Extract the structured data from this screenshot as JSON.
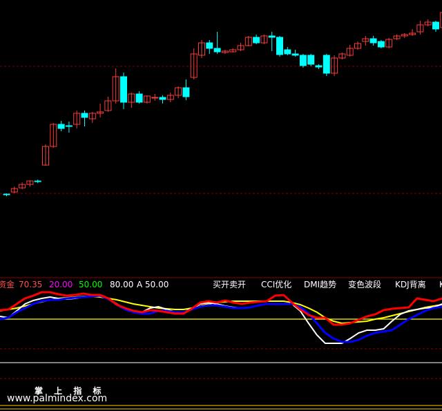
{
  "chart_data": {
    "type": "candlestick",
    "colors": {
      "background": "#000000",
      "up": "#ff3b3b",
      "down": "#00ffff",
      "grid": "#8b0000",
      "line_white": "#ffffff",
      "line_blue": "#0000ff",
      "line_red": "#ff0000",
      "line_yellow": "#ffff00"
    },
    "candles": [
      [
        281,
        282,
        280,
        284
      ],
      [
        278,
        273,
        270,
        280
      ],
      [
        272,
        267,
        264,
        274
      ],
      [
        267,
        262,
        261,
        270
      ],
      [
        262,
        263,
        260,
        265
      ],
      [
        239,
        212,
        209,
        240
      ],
      [
        212,
        180,
        178,
        214
      ],
      [
        180,
        186,
        175,
        190
      ],
      [
        182,
        182,
        176,
        192
      ],
      [
        180,
        164,
        160,
        186
      ],
      [
        164,
        170,
        160,
        183
      ],
      [
        172,
        164,
        162,
        178
      ],
      [
        164,
        162,
        150,
        170
      ],
      [
        160,
        146,
        140,
        162
      ],
      [
        146,
        111,
        99,
        150
      ],
      [
        111,
        148,
        105,
        158
      ],
      [
        148,
        136,
        134,
        156
      ],
      [
        136,
        148,
        132,
        150
      ],
      [
        148,
        139,
        138,
        150
      ],
      [
        142,
        141,
        136,
        146
      ],
      [
        141,
        144,
        138,
        150
      ],
      [
        144,
        138,
        134,
        148
      ],
      [
        138,
        127,
        125,
        142
      ],
      [
        127,
        140,
        115,
        145
      ],
      [
        112,
        78,
        70,
        115
      ],
      [
        80,
        62,
        58,
        84
      ],
      [
        62,
        70,
        58,
        78
      ],
      [
        70,
        75,
        46,
        78
      ],
      [
        76,
        74,
        72,
        78
      ],
      [
        75,
        72,
        70,
        76
      ],
      [
        72,
        66,
        62,
        74
      ],
      [
        66,
        54,
        52,
        67
      ],
      [
        54,
        62,
        50,
        64
      ],
      [
        62,
        52,
        50,
        64
      ],
      [
        52,
        54,
        46,
        74
      ],
      [
        54,
        79,
        52,
        82
      ],
      [
        72,
        78,
        68,
        80
      ],
      [
        78,
        80,
        72,
        82
      ],
      [
        80,
        95,
        78,
        98
      ],
      [
        80,
        93,
        78,
        96
      ],
      [
        95,
        97,
        93,
        100
      ],
      [
        80,
        106,
        78,
        110
      ],
      [
        106,
        84,
        80,
        110
      ],
      [
        84,
        78,
        76,
        86
      ],
      [
        80,
        70,
        65,
        82
      ],
      [
        70,
        63,
        60,
        72
      ],
      [
        60,
        56,
        52,
        66
      ],
      [
        56,
        62,
        52,
        66
      ],
      [
        60,
        68,
        58,
        70
      ],
      [
        68,
        57,
        55,
        70
      ],
      [
        56,
        52,
        50,
        58
      ],
      [
        52,
        50,
        48,
        55
      ],
      [
        50,
        48,
        42,
        52
      ],
      [
        46,
        36,
        30,
        50
      ],
      [
        36,
        32,
        28,
        38
      ],
      [
        32,
        42,
        30,
        46
      ],
      [
        40,
        18,
        10,
        45
      ]
    ],
    "ref_lines": [
      96,
      280
    ],
    "indicator": {
      "ref_lines": [
        462,
        505,
        525,
        548
      ],
      "white": [
        458,
        460,
        450,
        440,
        435,
        432,
        430,
        432,
        433,
        432,
        430,
        428,
        427,
        432,
        440,
        448,
        452,
        452,
        446,
        444,
        448,
        452,
        452,
        446,
        440,
        438,
        440,
        443,
        445,
        446,
        445,
        442,
        440,
        440,
        440,
        440,
        450,
        468,
        485,
        497,
        497,
        497,
        490,
        482,
        478,
        478,
        476,
        465,
        455,
        450,
        448,
        446,
        445,
        440
      ],
      "blue": [
        462,
        460,
        452,
        446,
        440,
        436,
        434,
        434,
        432,
        431,
        430,
        429,
        428,
        433,
        441,
        448,
        452,
        454,
        454,
        450,
        450,
        452,
        452,
        448,
        444,
        442,
        442,
        444,
        446,
        446,
        445,
        442,
        440,
        440,
        440,
        440,
        444,
        454,
        468,
        482,
        490,
        495,
        495,
        492,
        486,
        482,
        480,
        478,
        470,
        462,
        456,
        450,
        446,
        444
      ],
      "red": [
        449,
        448,
        440,
        432,
        428,
        423,
        423,
        426,
        428,
        427,
        425,
        427,
        427,
        432,
        441,
        446,
        450,
        452,
        449,
        450,
        452,
        454,
        454,
        447,
        438,
        436,
        438,
        435,
        438,
        440,
        438,
        437,
        436,
        428,
        427,
        438,
        448,
        456,
        460,
        460,
        470,
        470,
        468,
        463,
        458,
        455,
        449,
        447,
        446,
        445,
        432,
        434,
        436,
        432
      ],
      "yellow": [
        450,
        448,
        446,
        443,
        440,
        437,
        434,
        432,
        431,
        430,
        429,
        429,
        430,
        432,
        434,
        437,
        440,
        442,
        444,
        446,
        447,
        448,
        448,
        446,
        443,
        440,
        438,
        437,
        436,
        436,
        436,
        436,
        436,
        436,
        436,
        438,
        441,
        446,
        452,
        460,
        465,
        468,
        467,
        466,
        465,
        462,
        460,
        457,
        454,
        451,
        448,
        445,
        443,
        441
      ]
    },
    "legend_bar": [
      {
        "text": "资金",
        "color": "#ff4d4d"
      },
      {
        "text": "70.35",
        "color": "#ff4d4d"
      },
      {
        "text": "20.00",
        "color": "#ff00ff"
      },
      {
        "text": "50.00",
        "color": "#00ff00"
      },
      {
        "text": "80.00",
        "color": "#ffffff"
      },
      {
        "text": "A 50.00",
        "color": "#ffffff"
      },
      {
        "text": "买开卖开",
        "color": "#ffffff"
      },
      {
        "text": "CCI优化",
        "color": "#ffffff"
      },
      {
        "text": "DMI趋势",
        "color": "#ffffff"
      },
      {
        "text": "变色波段",
        "color": "#ffffff"
      },
      {
        "text": "KDJ背离",
        "color": "#ffffff"
      },
      {
        "text": "K",
        "color": "#ffffff"
      }
    ]
  },
  "watermark": {
    "title": "掌 上 指 标",
    "url": "www.palmindex.com"
  }
}
